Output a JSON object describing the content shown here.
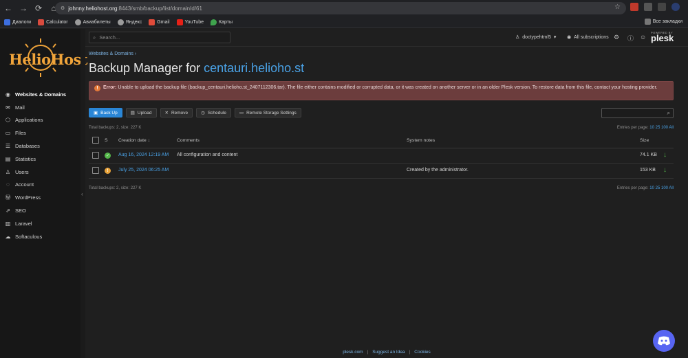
{
  "browser": {
    "url_host": "johnny.heliohost.org",
    "url_rest": ":8443/smb/backup/list/domainId/61",
    "bookmarks": [
      {
        "label": "Диалоги",
        "color": "#3d6fe0"
      },
      {
        "label": "Calculator",
        "color": "#d94b3e"
      },
      {
        "label": "Авиабилеты",
        "color": "#9b9b9b"
      },
      {
        "label": "Яндекс",
        "color": "#9b9b9b"
      },
      {
        "label": "Gmail",
        "color": "#e04b3a"
      },
      {
        "label": "YouTube",
        "color": "#e62117"
      },
      {
        "label": "Карты",
        "color": "#3fa34d"
      }
    ],
    "all_bookmarks": "Все закладки"
  },
  "sidebar": {
    "logo_text": "HelioHost",
    "items": [
      {
        "label": "Websites & Domains",
        "icon": "globe-icon",
        "active": true
      },
      {
        "label": "Mail",
        "icon": "mail-icon"
      },
      {
        "label": "Applications",
        "icon": "apps-icon"
      },
      {
        "label": "Files",
        "icon": "folder-icon"
      },
      {
        "label": "Databases",
        "icon": "database-icon"
      },
      {
        "label": "Statistics",
        "icon": "chart-icon"
      },
      {
        "label": "Users",
        "icon": "user-icon"
      },
      {
        "label": "Account",
        "icon": "account-icon"
      },
      {
        "label": "WordPress",
        "icon": "wordpress-icon"
      },
      {
        "label": "SEO",
        "icon": "seo-icon"
      },
      {
        "label": "Laravel",
        "icon": "laravel-icon"
      },
      {
        "label": "Softaculous",
        "icon": "softaculous-icon"
      }
    ]
  },
  "header": {
    "search_placeholder": "Search...",
    "username": "doctypehtml5",
    "subscriptions": "All subscriptions",
    "plesk_small": "POWERED BY",
    "plesk_big": "plesk"
  },
  "main": {
    "breadcrumb": "Websites & Domains",
    "title_prefix": "Backup Manager for ",
    "title_domain": "centauri.helioho.st",
    "error_label": "Error:",
    "error_text": "Unable to upload the backup file (backup_centauri.helioho.st_2407112306.tar). The file either contains modified or corrupted data, or it was created on another server or in an older Plesk version. To restore data from this file, contact your hosting provider.",
    "toolbar": {
      "backup": "Back Up",
      "upload": "Upload",
      "remove": "Remove",
      "schedule": "Schedule",
      "remote": "Remote Storage Settings"
    },
    "total_info": "Total backups: 2, size: 227 K",
    "entries_label": "Entries per page:",
    "entries_options": "10 25 100 All",
    "columns": {
      "s": "S",
      "creation_date": "Creation date",
      "sort_arrow": "↓",
      "comments": "Comments",
      "system_notes": "System notes",
      "size": "Size"
    },
    "rows": [
      {
        "date": "Aug 16, 2024 12:19 AM",
        "comments": "All configuration and content",
        "notes": "",
        "size": "74.1 KB",
        "status": "ok"
      },
      {
        "date": "July 25, 2024 06:25 AM",
        "comments": "",
        "notes": "Created by the administrator.",
        "size": "153 KB",
        "status": "warning"
      }
    ]
  },
  "footer": {
    "link1": "plesk.com",
    "link2": "Suggest an Idea",
    "link3": "Cookies"
  },
  "colors": {
    "accent": "#2a86d6",
    "error_bg": "#6c3d3d",
    "logo": "#f0a43a",
    "ok": "#55b84a",
    "warning": "#e8a33a"
  }
}
